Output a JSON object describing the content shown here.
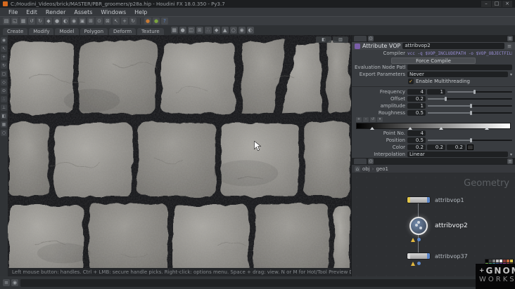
{
  "window": {
    "title": "C:/Houdini_Videos/brick/MASTER/PBR_groomers/p28a.hip - Houdini FX 18.0.350 - Py3.7",
    "controls": [
      "–",
      "□",
      "×"
    ]
  },
  "menubar": {
    "items": [
      "File",
      "Edit",
      "Render",
      "Assets",
      "Windows",
      "Help"
    ]
  },
  "toolbar": {
    "icons": [
      {
        "name": "new-scene-icon",
        "glyph": "▤"
      },
      {
        "name": "open-scene-icon",
        "glyph": "◱"
      },
      {
        "name": "save-scene-icon",
        "glyph": "▦"
      },
      {
        "name": "undo-icon",
        "glyph": "↺"
      },
      {
        "name": "redo-icon",
        "glyph": "↻"
      },
      {
        "name": "objects-mode-icon",
        "glyph": "◆"
      },
      {
        "name": "geometry-mode-icon",
        "glyph": "●"
      },
      {
        "name": "dynamics-mode-icon",
        "glyph": "◐"
      },
      {
        "name": "materials-icon",
        "glyph": "◉"
      },
      {
        "name": "render-view-icon",
        "glyph": "▣"
      },
      {
        "name": "snap-grid-icon",
        "glyph": "⊞"
      },
      {
        "name": "snap-point-icon",
        "glyph": "⊙"
      },
      {
        "name": "ortho-toggle-icon",
        "glyph": "⊠"
      },
      {
        "name": "select-mode-icon",
        "glyph": "↖"
      },
      {
        "name": "move-mode-icon",
        "glyph": "+"
      },
      {
        "name": "rotate-mode-icon",
        "glyph": "↻"
      }
    ],
    "accent_icons": [
      {
        "name": "render-task-icon",
        "glyph": "●",
        "color": "#c97b35"
      },
      {
        "name": "hqueue-icon",
        "glyph": "●",
        "color": "#7ba43f"
      },
      {
        "name": "help-icon",
        "glyph": "?",
        "color": "#5b86c9"
      }
    ]
  },
  "shelf": {
    "tabs": [
      "Create",
      "Modify",
      "Model",
      "Polygon",
      "Deform",
      "Texture"
    ],
    "tools": [
      {
        "name": "box-tool-icon",
        "glyph": "▦"
      },
      {
        "name": "sphere-tool-icon",
        "glyph": "●"
      },
      {
        "name": "tube-tool-icon",
        "glyph": "◫"
      },
      {
        "name": "grid-tool-icon",
        "glyph": "⊞"
      },
      {
        "name": "curve-tool-icon",
        "glyph": "∴"
      },
      {
        "name": "platonic-tool-icon",
        "glyph": "◆"
      },
      {
        "name": "lsystem-tool-icon",
        "glyph": "▲"
      },
      {
        "name": "null-tool-icon",
        "glyph": "○"
      },
      {
        "name": "light-tool-icon",
        "glyph": "◉"
      },
      {
        "name": "camera-tool-icon",
        "glyph": "◐"
      }
    ]
  },
  "left_toolbar": {
    "icons": [
      {
        "name": "view-tool-icon",
        "glyph": "◉"
      },
      {
        "name": "select-tool-icon",
        "glyph": "↖"
      },
      {
        "name": "translate-tool-icon",
        "glyph": "+"
      },
      {
        "name": "rotate-tool-icon",
        "glyph": "↻"
      },
      {
        "name": "scale-tool-icon",
        "glyph": "▢"
      },
      {
        "name": "handles-tool-icon",
        "glyph": "◇"
      },
      {
        "name": "snap-toggle-icon",
        "glyph": "⊙"
      },
      {
        "name": "display-points-icon",
        "glyph": "∴"
      },
      {
        "name": "display-normals-icon",
        "glyph": "⊥"
      },
      {
        "name": "shaded-display-icon",
        "glyph": "◧"
      },
      {
        "name": "wireframe-display-icon",
        "glyph": "▦"
      },
      {
        "name": "lights-display-icon",
        "glyph": "○"
      }
    ]
  },
  "viewport": {
    "hint": "Left mouse button: handles.  Ctrl + LMB: secure handle picks.  Right-click: options menu.  Space + drag: view.  N or M for Hot/Tool Preview Destination."
  },
  "params": {
    "node_type": "Attribute VOP",
    "node_name": "attribvop2",
    "compiler_label": "Compiler",
    "compiler_value": "vcc -q $VOP_INCLUDEPATH -o $VOP_OBJECTFILE -e $VOP_ERRORFILE $VOP_SOURCEFILE",
    "force_compile_label": "Force Compile",
    "eval_node_path_label": "Evaluation Node Path",
    "eval_node_path_value": "",
    "export_params_label": "Export Parameters",
    "export_params_value": "Never",
    "multithread_label": "Enable Multithreading",
    "fields": {
      "frequency": {
        "label": "Frequency",
        "values": [
          "4",
          "1"
        ]
      },
      "offset": {
        "label": "Offset",
        "values": [
          "0.2"
        ]
      },
      "amplitude": {
        "label": "amplitude",
        "values": [
          "1"
        ]
      },
      "roughness": {
        "label": "Roughness",
        "values": [
          "0.5"
        ]
      }
    },
    "ramp": {
      "point_label": "Point No.",
      "point_value": "4",
      "position_label": "Position",
      "position_value": "0.5",
      "color_label": "Color",
      "color_values": [
        "0.2",
        "0.2",
        "0.2"
      ],
      "interp_label": "Interpolation",
      "interp_value": "Linear"
    }
  },
  "network": {
    "context_label": "Geometry",
    "breadcrumb": [
      "obj",
      "geo1"
    ],
    "nodes": [
      {
        "name": "attribvop1"
      },
      {
        "name": "attribvop2"
      },
      {
        "name": "attribvop37"
      }
    ]
  },
  "palette": {
    "colors": [
      "#000000",
      "#404040",
      "#808080",
      "#bfbfbf",
      "#ffffff",
      "#8c3b3b",
      "#c46a3a",
      "#d8c24a",
      "#6a9e3f",
      "#3f9e6a",
      "#3f8c9e",
      "#3f5a9e",
      "#6a3f9e",
      "#9e3f8c",
      "#9e3f52",
      "#5a3f28",
      "#d98c8c",
      "#d9b38c",
      "#d9d98c",
      "#8cd98c",
      "#8cd9d9",
      "#8ca6d9",
      "#b38cd9",
      "#d98cc6",
      "#f2d5a0",
      "#a0b8f2",
      "#c9f2a0",
      "#f2a0a0",
      "#a0f2e0",
      "#e0a0f2",
      "#f2f2f2",
      "#1a1a1a"
    ]
  },
  "watermark": {
    "plus": "+",
    "line1": "GNOMON",
    "line2": "WORKSHOP"
  },
  "statusbar": {
    "left_icons": [
      {
        "name": "message-log-icon",
        "glyph": "≡"
      },
      {
        "name": "status-info-icon",
        "glyph": "◉"
      }
    ],
    "right_icons": [
      {
        "name": "layout-single-icon",
        "glyph": "▣"
      },
      {
        "name": "layout-split-icon",
        "glyph": "◫"
      },
      {
        "name": "cache-manager-icon",
        "glyph": "▦"
      }
    ]
  }
}
